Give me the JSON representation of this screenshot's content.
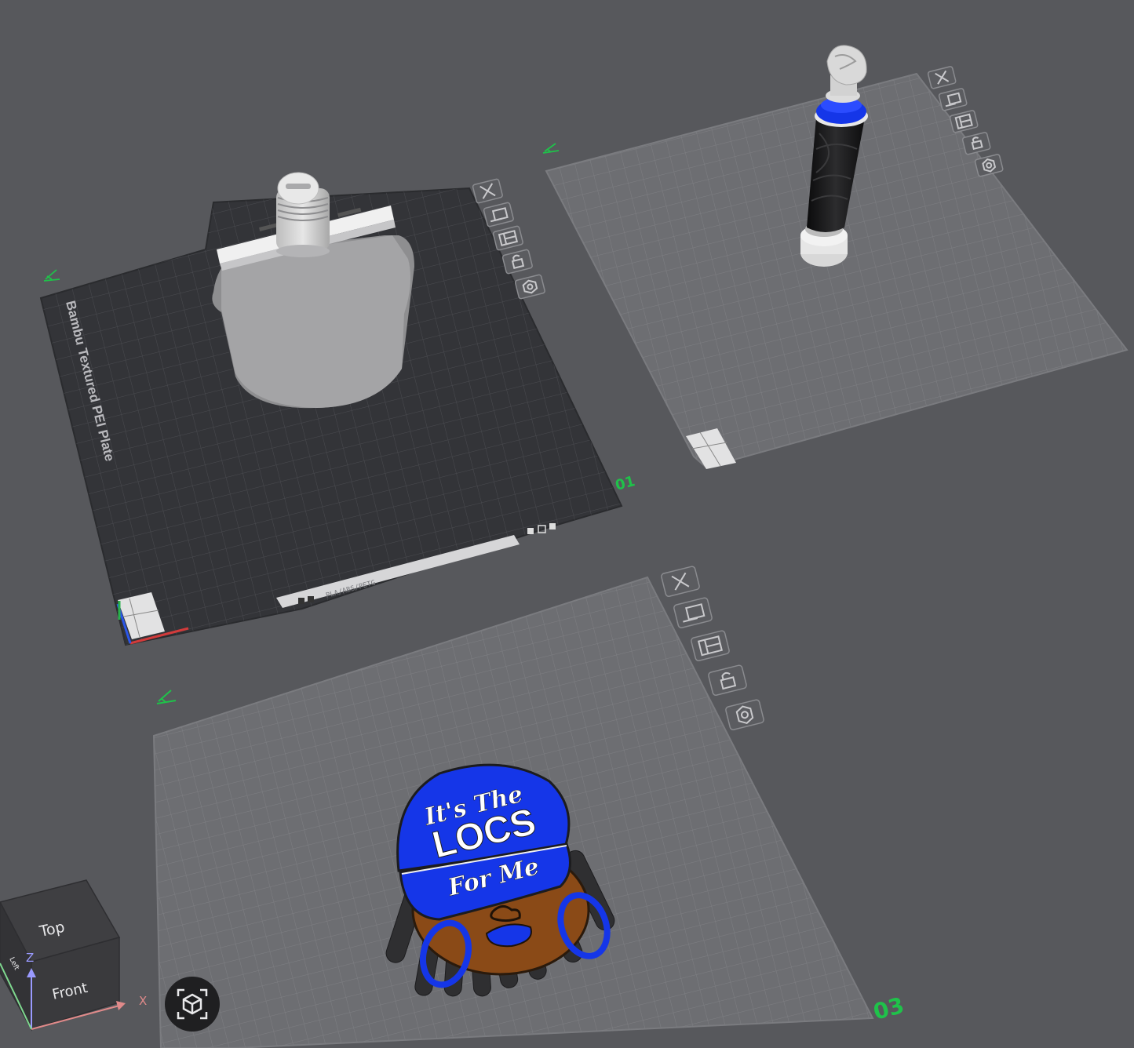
{
  "plates": [
    {
      "number": "01",
      "plate_name": "Bambu Textured PEI Plate",
      "filament_label": "PLA/ABS/PETG",
      "selected": true,
      "objects": [
        "bottle-head-model"
      ]
    },
    {
      "number": "",
      "selected": false,
      "objects": [
        "handle-model"
      ]
    },
    {
      "number": "03",
      "selected": false,
      "objects": [
        "locs-badge-model"
      ]
    }
  ],
  "badge_text": {
    "line1": "It's The",
    "line2": "LOCS",
    "line3": "For Me"
  },
  "view_cube": {
    "top": "Top",
    "front": "Front",
    "left": "Left"
  },
  "axes": {
    "x": "X",
    "z": "Z"
  },
  "colors": {
    "background": "#57585c",
    "plate_selected": "#333438",
    "plate_unselected": "#6d6e72",
    "plate_number": "#1fc24a",
    "accent_blue": "#1536e8",
    "skin": "#8a4a17"
  },
  "icons": [
    "close-icon",
    "auto-orient-icon",
    "arrange-icon",
    "lock-icon",
    "settings-icon",
    "edit-plate-icon",
    "orient-view-icon"
  ]
}
